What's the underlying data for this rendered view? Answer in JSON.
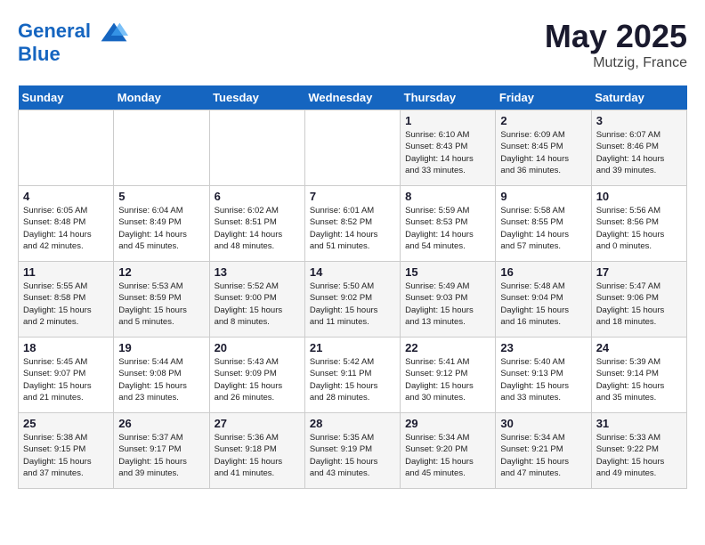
{
  "header": {
    "logo_line1": "General",
    "logo_line2": "Blue",
    "month_year": "May 2025",
    "location": "Mutzig, France"
  },
  "weekdays": [
    "Sunday",
    "Monday",
    "Tuesday",
    "Wednesday",
    "Thursday",
    "Friday",
    "Saturday"
  ],
  "weeks": [
    [
      {
        "day": "",
        "info": ""
      },
      {
        "day": "",
        "info": ""
      },
      {
        "day": "",
        "info": ""
      },
      {
        "day": "",
        "info": ""
      },
      {
        "day": "1",
        "info": "Sunrise: 6:10 AM\nSunset: 8:43 PM\nDaylight: 14 hours\nand 33 minutes."
      },
      {
        "day": "2",
        "info": "Sunrise: 6:09 AM\nSunset: 8:45 PM\nDaylight: 14 hours\nand 36 minutes."
      },
      {
        "day": "3",
        "info": "Sunrise: 6:07 AM\nSunset: 8:46 PM\nDaylight: 14 hours\nand 39 minutes."
      }
    ],
    [
      {
        "day": "4",
        "info": "Sunrise: 6:05 AM\nSunset: 8:48 PM\nDaylight: 14 hours\nand 42 minutes."
      },
      {
        "day": "5",
        "info": "Sunrise: 6:04 AM\nSunset: 8:49 PM\nDaylight: 14 hours\nand 45 minutes."
      },
      {
        "day": "6",
        "info": "Sunrise: 6:02 AM\nSunset: 8:51 PM\nDaylight: 14 hours\nand 48 minutes."
      },
      {
        "day": "7",
        "info": "Sunrise: 6:01 AM\nSunset: 8:52 PM\nDaylight: 14 hours\nand 51 minutes."
      },
      {
        "day": "8",
        "info": "Sunrise: 5:59 AM\nSunset: 8:53 PM\nDaylight: 14 hours\nand 54 minutes."
      },
      {
        "day": "9",
        "info": "Sunrise: 5:58 AM\nSunset: 8:55 PM\nDaylight: 14 hours\nand 57 minutes."
      },
      {
        "day": "10",
        "info": "Sunrise: 5:56 AM\nSunset: 8:56 PM\nDaylight: 15 hours\nand 0 minutes."
      }
    ],
    [
      {
        "day": "11",
        "info": "Sunrise: 5:55 AM\nSunset: 8:58 PM\nDaylight: 15 hours\nand 2 minutes."
      },
      {
        "day": "12",
        "info": "Sunrise: 5:53 AM\nSunset: 8:59 PM\nDaylight: 15 hours\nand 5 minutes."
      },
      {
        "day": "13",
        "info": "Sunrise: 5:52 AM\nSunset: 9:00 PM\nDaylight: 15 hours\nand 8 minutes."
      },
      {
        "day": "14",
        "info": "Sunrise: 5:50 AM\nSunset: 9:02 PM\nDaylight: 15 hours\nand 11 minutes."
      },
      {
        "day": "15",
        "info": "Sunrise: 5:49 AM\nSunset: 9:03 PM\nDaylight: 15 hours\nand 13 minutes."
      },
      {
        "day": "16",
        "info": "Sunrise: 5:48 AM\nSunset: 9:04 PM\nDaylight: 15 hours\nand 16 minutes."
      },
      {
        "day": "17",
        "info": "Sunrise: 5:47 AM\nSunset: 9:06 PM\nDaylight: 15 hours\nand 18 minutes."
      }
    ],
    [
      {
        "day": "18",
        "info": "Sunrise: 5:45 AM\nSunset: 9:07 PM\nDaylight: 15 hours\nand 21 minutes."
      },
      {
        "day": "19",
        "info": "Sunrise: 5:44 AM\nSunset: 9:08 PM\nDaylight: 15 hours\nand 23 minutes."
      },
      {
        "day": "20",
        "info": "Sunrise: 5:43 AM\nSunset: 9:09 PM\nDaylight: 15 hours\nand 26 minutes."
      },
      {
        "day": "21",
        "info": "Sunrise: 5:42 AM\nSunset: 9:11 PM\nDaylight: 15 hours\nand 28 minutes."
      },
      {
        "day": "22",
        "info": "Sunrise: 5:41 AM\nSunset: 9:12 PM\nDaylight: 15 hours\nand 30 minutes."
      },
      {
        "day": "23",
        "info": "Sunrise: 5:40 AM\nSunset: 9:13 PM\nDaylight: 15 hours\nand 33 minutes."
      },
      {
        "day": "24",
        "info": "Sunrise: 5:39 AM\nSunset: 9:14 PM\nDaylight: 15 hours\nand 35 minutes."
      }
    ],
    [
      {
        "day": "25",
        "info": "Sunrise: 5:38 AM\nSunset: 9:15 PM\nDaylight: 15 hours\nand 37 minutes."
      },
      {
        "day": "26",
        "info": "Sunrise: 5:37 AM\nSunset: 9:17 PM\nDaylight: 15 hours\nand 39 minutes."
      },
      {
        "day": "27",
        "info": "Sunrise: 5:36 AM\nSunset: 9:18 PM\nDaylight: 15 hours\nand 41 minutes."
      },
      {
        "day": "28",
        "info": "Sunrise: 5:35 AM\nSunset: 9:19 PM\nDaylight: 15 hours\nand 43 minutes."
      },
      {
        "day": "29",
        "info": "Sunrise: 5:34 AM\nSunset: 9:20 PM\nDaylight: 15 hours\nand 45 minutes."
      },
      {
        "day": "30",
        "info": "Sunrise: 5:34 AM\nSunset: 9:21 PM\nDaylight: 15 hours\nand 47 minutes."
      },
      {
        "day": "31",
        "info": "Sunrise: 5:33 AM\nSunset: 9:22 PM\nDaylight: 15 hours\nand 49 minutes."
      }
    ]
  ]
}
